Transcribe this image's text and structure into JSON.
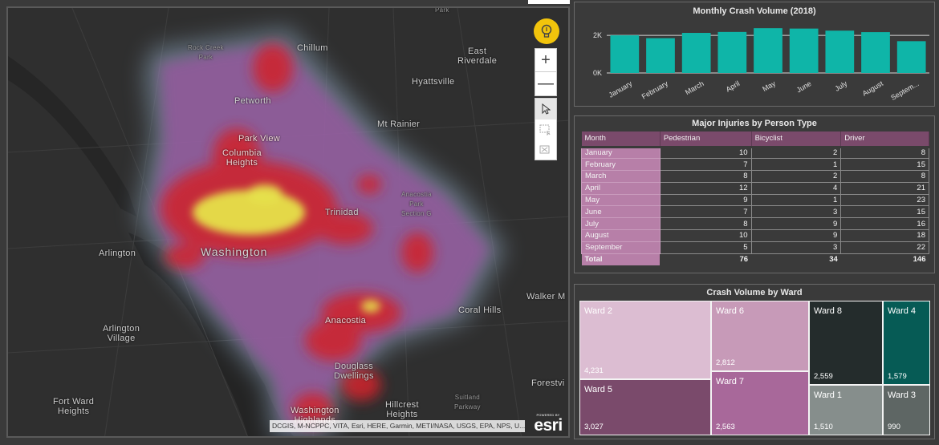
{
  "map": {
    "places": [
      {
        "name": "Rock Creek\nPark",
        "size": "small"
      },
      {
        "name": "Chillum",
        "size": "med"
      },
      {
        "name": "East\nRiverdale",
        "size": "med"
      },
      {
        "name": "Hyattsville",
        "size": "med"
      },
      {
        "name": "Petworth",
        "size": "med"
      },
      {
        "name": "Mt Rainier",
        "size": "med"
      },
      {
        "name": "Park View",
        "size": "med"
      },
      {
        "name": "Columbia\nHeights",
        "size": "med"
      },
      {
        "name": "Anacostia\nPark\nSection G",
        "size": "small"
      },
      {
        "name": "Trinidad",
        "size": "med"
      },
      {
        "name": "Arlington",
        "size": "med"
      },
      {
        "name": "Washington",
        "size": "big"
      },
      {
        "name": "Walker M",
        "size": "med"
      },
      {
        "name": "Coral Hills",
        "size": "med"
      },
      {
        "name": "Arlington\nVillage",
        "size": "med"
      },
      {
        "name": "Anacostia",
        "size": "med"
      },
      {
        "name": "Douglass\nDwellings",
        "size": "med"
      },
      {
        "name": "Forestvi",
        "size": "med"
      },
      {
        "name": "Suitland\nParkway",
        "size": "small"
      },
      {
        "name": "Fort Ward\nHeights",
        "size": "med"
      },
      {
        "name": "Hillcrest\nHeights",
        "size": "med"
      },
      {
        "name": "Washington\nHighlands",
        "size": "med"
      },
      {
        "name": "Park",
        "size": "small"
      }
    ],
    "attribution": "DCGIS, M-NCPPC, VITA, Esri, HERE, Garmin, METI/NASA, USGS, EPA, NPS, U...",
    "logo_small": "POWERED BY",
    "logo": "esri",
    "controls": {
      "zoom_in": "+",
      "zoom_out": "—"
    },
    "heat_colors": {
      "low": "#8fa8c0",
      "mid": "#a050a0",
      "high": "#d0202a",
      "peak": "#e6e24a"
    }
  },
  "bar_chart": {
    "title": "Monthly Crash Volume (2018)",
    "bar_color": "#0fb5a8"
  },
  "chart_data": {
    "type": "bar",
    "title": "Monthly Crash Volume (2018)",
    "categories": [
      "January",
      "February",
      "March",
      "April",
      "May",
      "June",
      "July",
      "August",
      "Septem..."
    ],
    "values": [
      2000,
      1850,
      2130,
      2180,
      2380,
      2360,
      2250,
      2170,
      1690
    ],
    "ylim": [
      0,
      2600
    ],
    "yticks": [
      0,
      2000
    ],
    "yticklabels": [
      "0K",
      "2K"
    ],
    "xlabel": "",
    "ylabel": "",
    "grid": true
  },
  "table": {
    "title": "Major Injuries by Person Type",
    "columns": [
      "Month",
      "Pedestrian",
      "Bicyclist",
      "Driver"
    ],
    "rows": [
      [
        "January",
        "10",
        "2",
        "8"
      ],
      [
        "February",
        "7",
        "1",
        "15"
      ],
      [
        "March",
        "8",
        "2",
        "8"
      ],
      [
        "April",
        "12",
        "4",
        "21"
      ],
      [
        "May",
        "9",
        "1",
        "23"
      ],
      [
        "June",
        "7",
        "3",
        "15"
      ],
      [
        "July",
        "8",
        "9",
        "16"
      ],
      [
        "August",
        "10",
        "9",
        "18"
      ],
      [
        "September",
        "5",
        "3",
        "22"
      ]
    ],
    "total": [
      "Total",
      "76",
      "34",
      "146"
    ]
  },
  "treemap": {
    "title": "Crash Volume by Ward",
    "tiles": [
      {
        "label": "Ward 2",
        "value": "4,231",
        "color": "#dcbdd2",
        "text": "#ffffff"
      },
      {
        "label": "Ward 5",
        "value": "3,027",
        "color": "#7a4a6b",
        "text": "#ffffff"
      },
      {
        "label": "Ward 6",
        "value": "2,812",
        "color": "#c79ab8",
        "text": "#ffffff"
      },
      {
        "label": "Ward 7",
        "value": "2,563",
        "color": "#a8689a",
        "text": "#ffffff"
      },
      {
        "label": "Ward 8",
        "value": "2,559",
        "color": "#242c2c",
        "text": "#ffffff"
      },
      {
        "label": "Ward 4",
        "value": "1,579",
        "color": "#065b55",
        "text": "#ffffff"
      },
      {
        "label": "Ward 1",
        "value": "1,510",
        "color": "#868e8c",
        "text": "#ffffff"
      },
      {
        "label": "Ward 3",
        "value": "990",
        "color": "#5e6664",
        "text": "#ffffff"
      }
    ]
  }
}
